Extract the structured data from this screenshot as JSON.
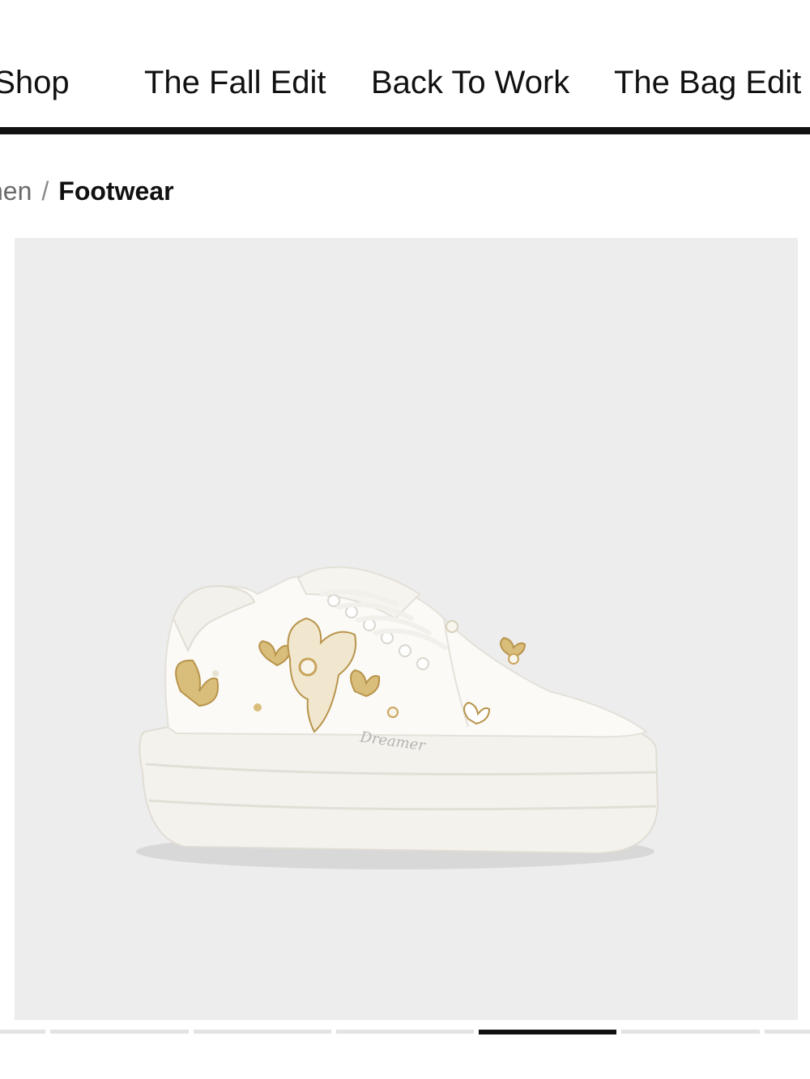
{
  "nav": {
    "items": [
      {
        "label": "t Shop"
      },
      {
        "label": "The Fall Edit"
      },
      {
        "label": "Back To Work"
      },
      {
        "label": "The Bag Edit"
      }
    ]
  },
  "breadcrumb": {
    "parent": "nen",
    "separator": "/",
    "current": "Footwear"
  },
  "product": {
    "image_alt": "White platform sneaker with gold butterfly embellishments",
    "shoe_text": "Dreamer"
  },
  "carousel": {
    "total": 7,
    "active_index": 4
  },
  "colors": {
    "image_background": "#ededed",
    "accent": "#111111",
    "gold": "#c9a45c"
  }
}
